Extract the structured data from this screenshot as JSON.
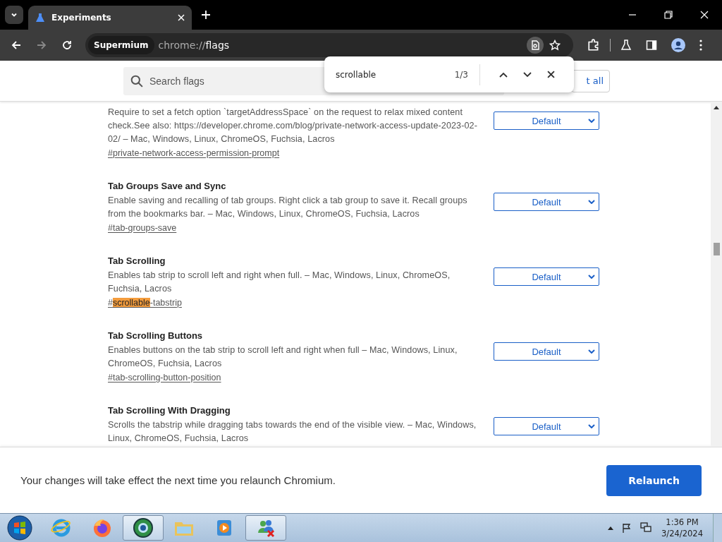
{
  "browser": {
    "tab_title": "Experiments",
    "url_chip": "Supermium",
    "url": "chrome://flags"
  },
  "header": {
    "search_placeholder": "Search flags",
    "reset_button": "t all"
  },
  "find_bar": {
    "query": "scrollable",
    "count": "1/3"
  },
  "flags": [
    {
      "description": "Require to set a fetch option `targetAddressSpace` on the request to relax mixed content check.See also: https://developer.chrome.com/blog/private-network-access-update-2023-02-02/ – Mac, Windows, Linux, ChromeOS, Fuchsia, Lacros",
      "link_parts": [
        {
          "text": "#private-network-access-permission-prompt",
          "match": false
        }
      ],
      "value": "Default"
    },
    {
      "title": "Tab Groups Save and Sync",
      "description": "Enable saving and recalling of tab groups. Right click a tab group to save it. Recall groups from the bookmarks bar. – Mac, Windows, Linux, ChromeOS, Fuchsia, Lacros",
      "link_parts": [
        {
          "text": "#tab-groups-save",
          "match": false
        }
      ],
      "value": "Default"
    },
    {
      "title": "Tab Scrolling",
      "description": "Enables tab strip to scroll left and right when full. – Mac, Windows, Linux, ChromeOS, Fuchsia, Lacros",
      "link_parts": [
        {
          "text": "#",
          "match": false
        },
        {
          "text": "scrollable",
          "match": true
        },
        {
          "text": "-tabstrip",
          "match": false
        }
      ],
      "value": "Default"
    },
    {
      "title": "Tab Scrolling Buttons",
      "description": "Enables buttons on the tab strip to scroll left and right when full – Mac, Windows, Linux, ChromeOS, Fuchsia, Lacros",
      "link_parts": [
        {
          "text": "#tab-scrolling-button-position",
          "match": false
        }
      ],
      "value": "Default"
    },
    {
      "title": "Tab Scrolling With Dragging",
      "description": "Scrolls the tabstrip while dragging tabs towards the end of the visible view. – Mac, Windows, Linux, ChromeOS, Fuchsia, Lacros",
      "value": "Default"
    }
  ],
  "footer": {
    "message": "Your changes will take effect the next time you relaunch Chromium.",
    "button": "Relaunch"
  },
  "taskbar": {
    "apps": [
      {
        "kind": "ie",
        "selected": false
      },
      {
        "kind": "firefox",
        "selected": false
      },
      {
        "kind": "globe",
        "selected": true
      },
      {
        "kind": "folder",
        "selected": false
      },
      {
        "kind": "media",
        "selected": false
      },
      {
        "kind": "people",
        "selected": true
      }
    ],
    "time": "1:36 PM",
    "date": "3/24/2024"
  }
}
